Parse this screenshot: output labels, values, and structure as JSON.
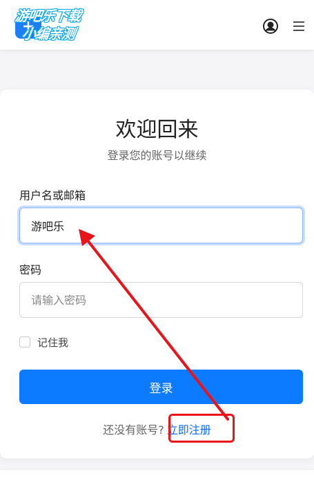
{
  "header": {
    "logo_glyph": "+",
    "watermark_line1": "游吧乐下载",
    "watermark_line2": "小编亲测",
    "user_icon": "user-circle-icon",
    "menu_icon": "hamburger-menu-icon"
  },
  "login": {
    "title": "欢迎回来",
    "subtitle": "登录您的账号以继续",
    "username_label": "用户名或邮箱",
    "username_value": "游吧乐",
    "password_label": "密码",
    "password_placeholder": "请输入密码",
    "remember_label": "记住我",
    "submit_label": "登录",
    "no_account_text": "还没有账号?",
    "register_label": "立即注册"
  },
  "colors": {
    "primary": "#0d7bff",
    "link": "#0d6efd",
    "annotation": "#e8141a"
  }
}
